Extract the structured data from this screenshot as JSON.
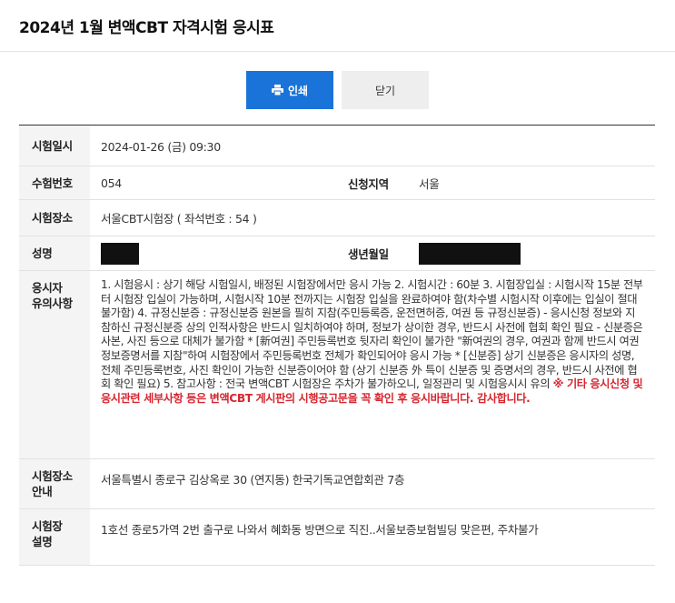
{
  "header": {
    "title": "2024년 1월 변액CBT 자격시험 응시표"
  },
  "buttons": {
    "print_label": "인쇄",
    "close_label": "닫기"
  },
  "exam": {
    "datetime_label": "시험일시",
    "datetime_value": "2024-01-26 (금) 09:30",
    "number_label": "수험번호",
    "number_value": "054",
    "region_label": "신청지역",
    "region_value": "서울",
    "venue_label": "시험장소",
    "venue_value": "서울CBT시험장 ( 좌석번호 : 54 )",
    "name_label": "성명",
    "birth_label": "생년월일",
    "notice_label_1": "응시자",
    "notice_label_2": "유의사항",
    "notice_text": "1. 시험응시 : 상기 해당 시험일시, 배정된 시험장에서만 응시 가능 2. 시험시간 : 60분 3. 시험장입실 : 시험시작 15분 전부터 시험장 입실이 가능하며, 시험시작 10분 전까지는 시험장 입실을 완료하여야 함(차수별 시험시작 이후에는 입실이 절대 불가함) 4. 규정신분증 : 규정신분증 원본을 필히 지참(주민등록증, 운전면허증, 여권 등 규정신분증) - 응시신청 정보와 지참하신 규정신분증 상의 인적사항은 반드시 일치하여야 하며, 정보가 상이한 경우, 반드시 사전에 협회 확인 필요 - 신분증은 사본, 사진 등으로 대체가 불가함 * [新여권] 주민등록번호 뒷자리 확인이 불가한 \"新여권의 경우, 여권과 함께 반드시 여권정보증명서를 지참\"하여 시험장에서 주민등록번호 전체가 확인되어야 응시 가능 * [신분증] 상기 신분증은 응시자의 성명, 전체 주민등록번호, 사진 확인이 가능한 신분증이어야 함 (상기 신분증 外 특이 신분증 및 증명서의 경우, 반드시 사전에 협회 확인 필요) 5. 참고사항 : 전국 변액CBT 시험장은 주차가 불가하오니, 일정관리 및 시험응시시 유의 ",
    "notice_warning": "※ 기타 응시신청 및 응시관련 세부사항 등은 변액CBT 게시판의 시행공고문을 꼭 확인 후 응시바랍니다. 감사합니다.",
    "venue_guide_label_1": "시험장소",
    "venue_guide_label_2": "안내",
    "venue_guide_value": "서울특별시 종로구 김상옥로 30 (연지동) 한국기독교연합회관 7층",
    "venue_desc_label_1": "시험장",
    "venue_desc_label_2": "설명",
    "venue_desc_value": "1호선 종로5가역 2번 출구로 나와서 혜화동 방면으로 직진..서울보증보험빌딩 맞은편, 주차불가"
  },
  "colors": {
    "accent": "#1a73d9",
    "warning": "#d6262f",
    "label_bg": "#f4f4f4"
  },
  "icons": {
    "print": "printer-icon"
  }
}
